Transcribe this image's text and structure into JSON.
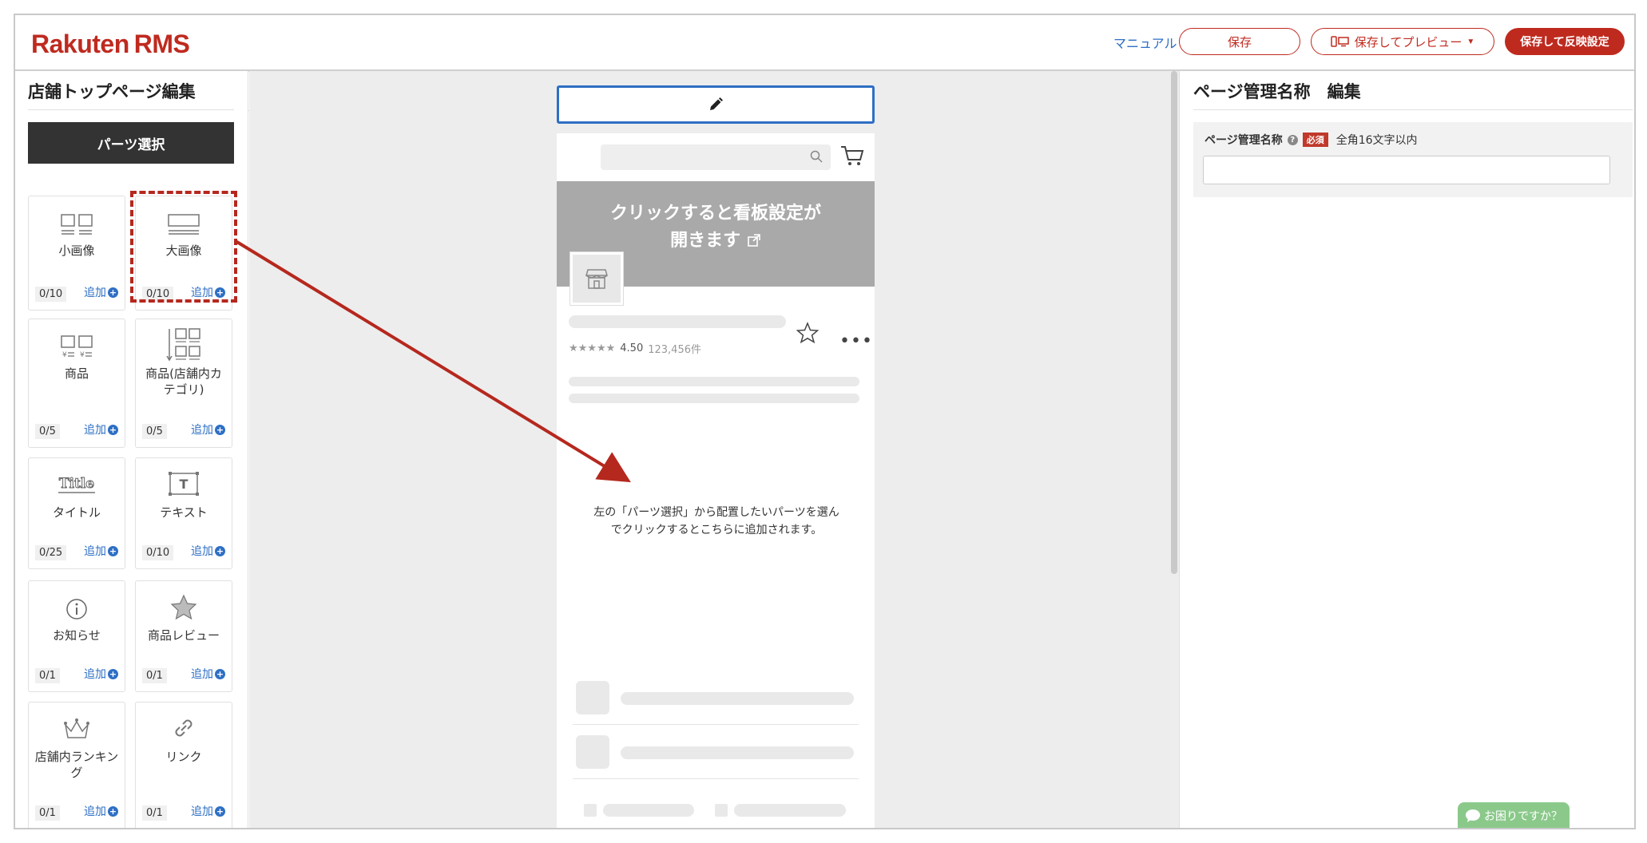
{
  "header": {
    "logo_main": "Rakuten",
    "logo_sub": "RMS",
    "manual": "マニュアル",
    "save": "保存",
    "save_preview": "保存してプレビュー",
    "save_publish": "保存して反映設定"
  },
  "sidebar": {
    "title": "店舗トップページ編集",
    "parts_header": "パーツ選択",
    "add_label": "追加",
    "parts": [
      {
        "label": "小画像",
        "count": "0/10"
      },
      {
        "label": "大画像",
        "count": "0/10"
      },
      {
        "label": "商品",
        "count": "0/5"
      },
      {
        "label": "商品(店舗内カテゴリ)",
        "count": "0/5"
      },
      {
        "label": "タイトル",
        "count": "0/25"
      },
      {
        "label": "テキスト",
        "count": "0/10"
      },
      {
        "label": "お知らせ",
        "count": "0/1"
      },
      {
        "label": "商品レビュー",
        "count": "0/1"
      },
      {
        "label": "店舗内ランキング",
        "count": "0/1"
      },
      {
        "label": "リンク",
        "count": "0/1"
      }
    ]
  },
  "preview": {
    "banner_line1": "クリックすると看板設定が",
    "banner_line2": "開きます",
    "rating_value": "4.50",
    "rating_count": "123,456件",
    "hint_line1": "左の「パーツ選択」から配置したいパーツを選ん",
    "hint_line2": "でクリックするとこちらに追加されます。"
  },
  "right_panel": {
    "title": "ページ管理名称　編集",
    "field_label": "ページ管理名称",
    "required_badge": "必須",
    "limit_text": "全角16文字以内",
    "field_value": ""
  },
  "help_widget": {
    "label": "お困りですか？"
  },
  "colors": {
    "brand": "#bf2a1f",
    "link": "#2e6fc4",
    "highlight": "#b5281e"
  }
}
